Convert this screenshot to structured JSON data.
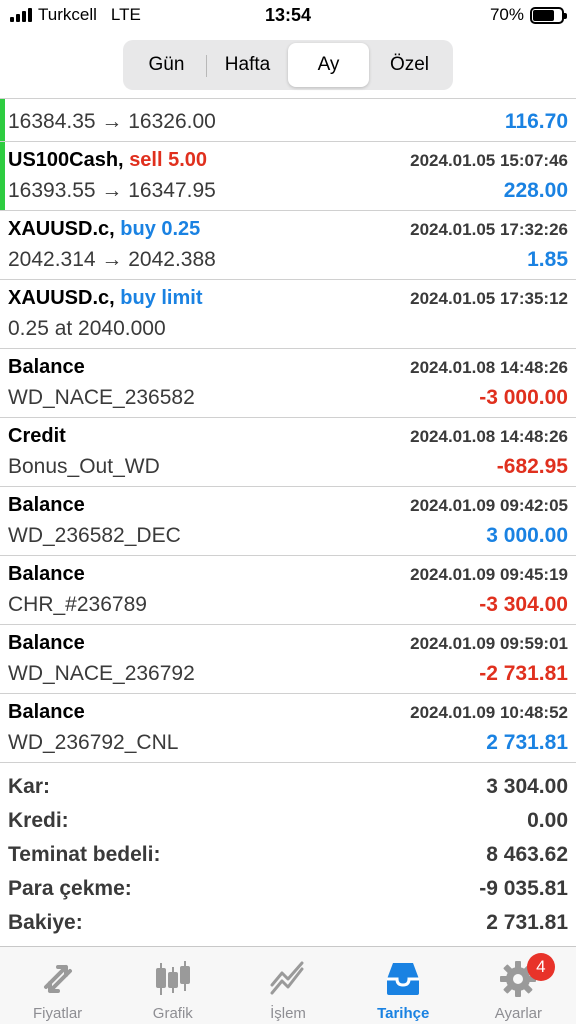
{
  "status_bar": {
    "carrier": "Turkcell",
    "network": "LTE",
    "time": "13:54",
    "battery": "70%"
  },
  "segments": [
    {
      "label": "Gün"
    },
    {
      "label": "Hafta"
    },
    {
      "label": "Ay"
    },
    {
      "label": "Özel"
    }
  ],
  "selected_segment": "Ay",
  "partial_row": {
    "prices": "16384.35 → 16326.00",
    "amount": "116.70"
  },
  "rows": [
    {
      "symbol": "US100Cash,",
      "action": "sell 5.00",
      "time": "2024.01.05 15:07:46",
      "detail": "16393.55 → 16347.95",
      "amount": "228.00"
    },
    {
      "symbol": "XAUUSD.c,",
      "action": "buy 0.25",
      "time": "2024.01.05 17:32:26",
      "detail": "2042.314 → 2042.388",
      "amount": "1.85"
    },
    {
      "symbol": "XAUUSD.c,",
      "action": "buy limit",
      "time": "2024.01.05 17:35:12",
      "detail": "0.25 at 2040.000",
      "amount": ""
    },
    {
      "symbol": "Balance",
      "action": "",
      "time": "2024.01.08 14:48:26",
      "detail": "WD_NACE_236582",
      "amount": "-3 000.00"
    },
    {
      "symbol": "Credit",
      "action": "",
      "time": "2024.01.08 14:48:26",
      "detail": "Bonus_Out_WD",
      "amount": "-682.95"
    },
    {
      "symbol": "Balance",
      "action": "",
      "time": "2024.01.09 09:42:05",
      "detail": "WD_236582_DEC",
      "amount": "3 000.00"
    },
    {
      "symbol": "Balance",
      "action": "",
      "time": "2024.01.09 09:45:19",
      "detail": "CHR_#236789",
      "amount": "-3 304.00"
    },
    {
      "symbol": "Balance",
      "action": "",
      "time": "2024.01.09 09:59:01",
      "detail": "WD_NACE_236792",
      "amount": "-2 731.81"
    },
    {
      "symbol": "Balance",
      "action": "",
      "time": "2024.01.09 10:48:52",
      "detail": "WD_236792_CNL",
      "amount": "2 731.81"
    }
  ],
  "summary": [
    {
      "label": "Kar:",
      "value": "3 304.00"
    },
    {
      "label": "Kredi:",
      "value": "0.00"
    },
    {
      "label": "Teminat bedeli:",
      "value": "8 463.62"
    },
    {
      "label": "Para çekme:",
      "value": "-9 035.81"
    },
    {
      "label": "Bakiye:",
      "value": "2 731.81"
    }
  ],
  "tabs": [
    {
      "label": "Fiyatlar",
      "icon": "quotes-icon"
    },
    {
      "label": "Grafik",
      "icon": "candlestick-icon"
    },
    {
      "label": "İşlem",
      "icon": "trade-icon"
    },
    {
      "label": "Tarihçe",
      "icon": "history-inbox-icon"
    },
    {
      "label": "Ayarlar",
      "icon": "gear-icon"
    }
  ],
  "settings_badge": "4",
  "colors": {
    "positive": "#1a82e2",
    "negative": "#e0301e",
    "active_tab": "#1a82e2",
    "badge": "#e8332a",
    "open_marker": "#2ecc40"
  }
}
